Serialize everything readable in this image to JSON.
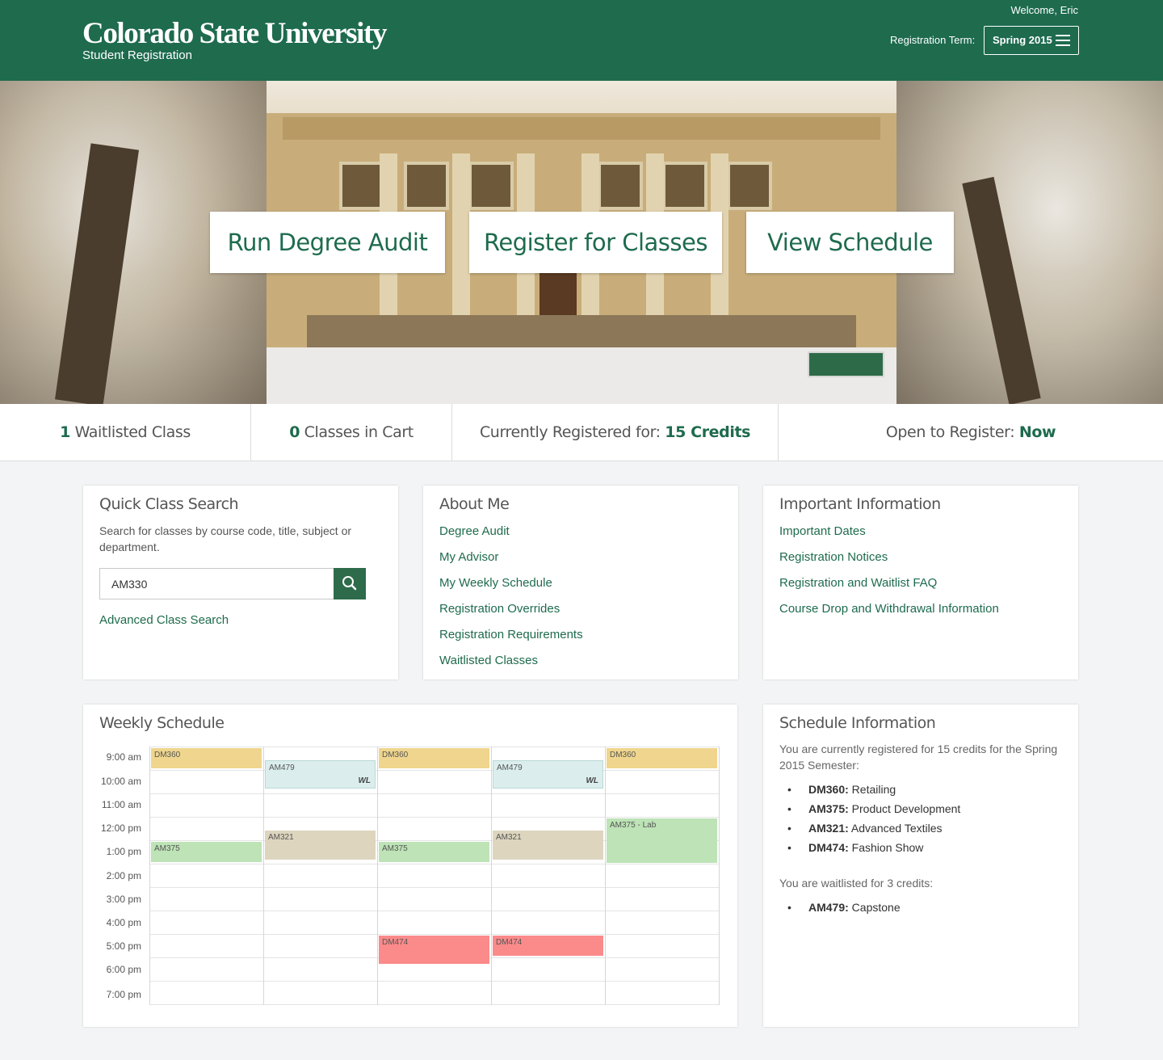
{
  "header": {
    "logo_title": "Colorado State University",
    "logo_sub": "Student Registration",
    "welcome": "Welcome, Eric",
    "term_label": "Registration Term:",
    "term_value": "Spring 2015"
  },
  "hero": {
    "buttons": [
      "Run Degree Audit",
      "Register for Classes",
      "View Schedule"
    ]
  },
  "stats": {
    "waitlisted_count": "1",
    "waitlisted_label": " Waitlisted Class",
    "cart_count": "0",
    "cart_label": " Classes in Cart",
    "registered_label": "Currently Registered for: ",
    "registered_value": "15 Credits",
    "open_label": "Open to Register: ",
    "open_value": "Now"
  },
  "quick_search": {
    "title": "Quick Class Search",
    "description": "Search for classes by course code, title, subject or department.",
    "input_value": "AM330",
    "advanced_link": "Advanced Class Search"
  },
  "about_me": {
    "title": "About Me",
    "links": [
      "Degree Audit",
      "My Advisor",
      "My Weekly Schedule",
      "Registration Overrides",
      "Registration Requirements",
      "Waitlisted Classes"
    ]
  },
  "important": {
    "title": "Important Information",
    "links": [
      "Important Dates",
      "Registration Notices",
      "Registration and Waitlist FAQ",
      "Course Drop and Withdrawal Information"
    ]
  },
  "weekly_schedule": {
    "title": "Weekly Schedule",
    "times": [
      "9:00 am",
      "10:00 am",
      "11:00 am",
      "12:00 pm",
      "1:00 pm",
      "2:00 pm",
      "3:00 pm",
      "4:00 pm",
      "5:00 pm",
      "6:00 pm",
      "7:00 pm"
    ],
    "events": [
      {
        "label": "DM360",
        "color": "#efd58d"
      },
      {
        "label": "AM479",
        "tag": "WL",
        "color": "#dbeeed"
      },
      {
        "label": "DM360",
        "color": "#efd58d"
      },
      {
        "label": "AM479",
        "tag": "WL",
        "color": "#dbeeed"
      },
      {
        "label": "DM360",
        "color": "#efd58d"
      },
      {
        "label": "AM375",
        "color": "#bde3b6"
      },
      {
        "label": "AM321",
        "color": "#ddd5be"
      },
      {
        "label": "AM375",
        "color": "#bde3b6"
      },
      {
        "label": "AM321",
        "color": "#ddd5be"
      },
      {
        "label": "AM375 - Lab",
        "color": "#bde3b6"
      },
      {
        "label": "DM474",
        "color": "#fb8a8a"
      },
      {
        "label": "DM474",
        "color": "#fb8a8a"
      }
    ]
  },
  "schedule_info": {
    "title": "Schedule Information",
    "registered_text": "You are currently registered for 15 credits for the Spring 2015 Semester:",
    "registered": [
      {
        "code": "DM360:",
        "name": " Retailing"
      },
      {
        "code": "AM375:",
        "name": " Product Development"
      },
      {
        "code": "AM321:",
        "name": " Advanced Textiles"
      },
      {
        "code": "DM474:",
        "name": " Fashion Show"
      }
    ],
    "waitlisted_text": "You are waitlisted for 3 credits:",
    "waitlisted": [
      {
        "code": "AM479:",
        "name": " Capstone"
      }
    ]
  },
  "colors": {
    "brand_green": "#1e6b4e",
    "search_button": "#2d6b4a"
  }
}
